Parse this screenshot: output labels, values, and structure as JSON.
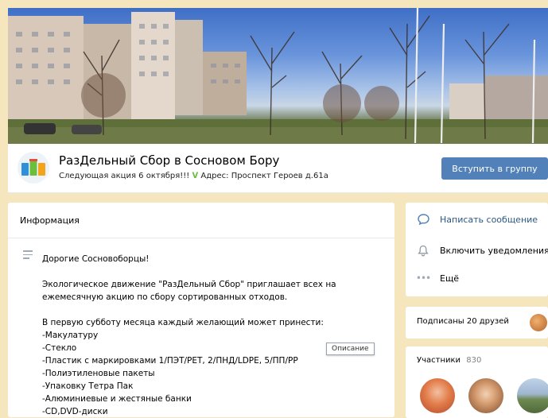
{
  "group": {
    "name": "РазДельный Сбор в Сосновом Бору",
    "status": "Следующая акция 6 октября!!!",
    "status_address": "Адрес: Проспект Героев д.61а",
    "join_label": "Вступить в группу"
  },
  "info": {
    "heading": "Информация",
    "lines": [
      "Дорогие Сосновоборцы!",
      "",
      "Экологическое движение \"РазДельный Сбор\" приглашает всех на",
      "ежемесячную акцию по сбору сортированных отходов.",
      "",
      "В первую субботу месяца каждый желающий может принести:",
      "-Макулатуру",
      "-Стекло",
      "-Пластик с маркировками 1/ПЭТ/PET, 2/ПНД/LDPE, 5/ПП/PP",
      "-Полиэтиленовые пакеты",
      "-Упаковку Тетра Пак",
      "-Алюминиевые и жестяные банки",
      "-CD,DVD-диски"
    ],
    "tooltip": "Описание"
  },
  "actions": {
    "message": "Написать сообщение",
    "notify": "Включить уведомления",
    "more": "Ещё"
  },
  "friends": {
    "label": "Подписаны 20 друзей"
  },
  "members": {
    "label": "Участники",
    "count": "830"
  },
  "colors": {
    "accent": "#5181b8",
    "page_bg": "#f5e6bd"
  }
}
